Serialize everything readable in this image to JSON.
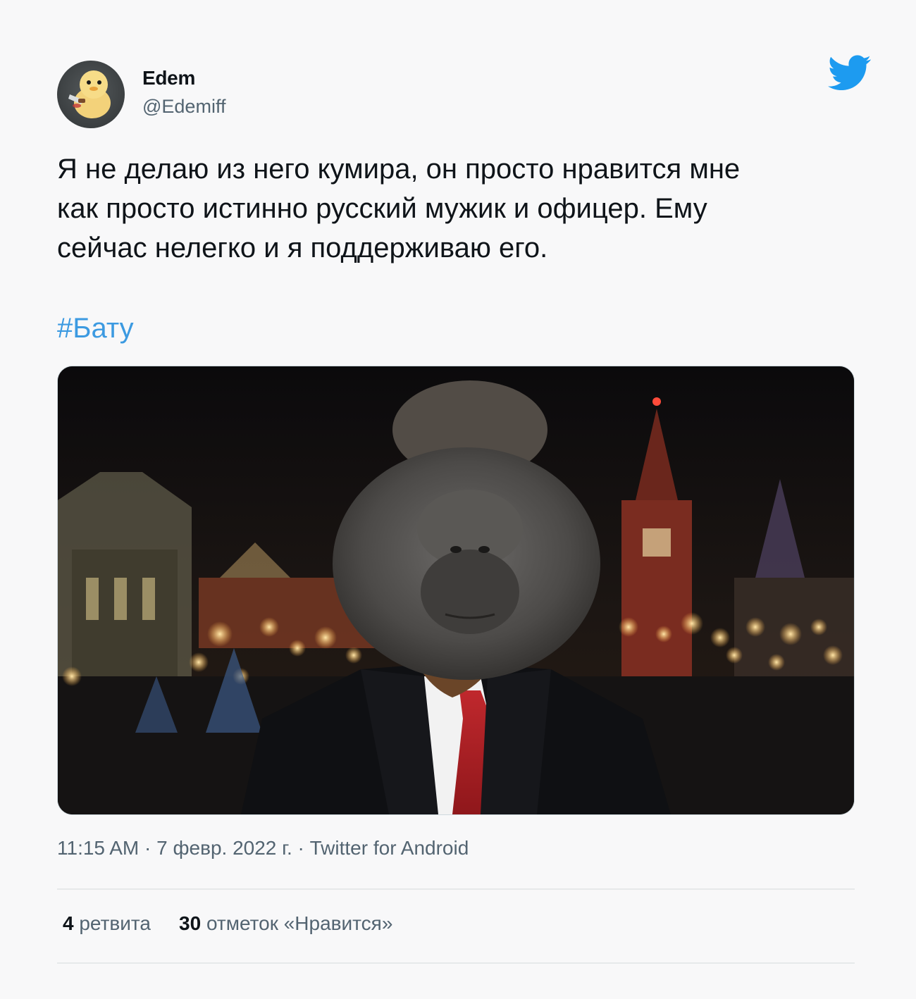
{
  "author": {
    "name": "Edem",
    "handle": "@Edemiff"
  },
  "tweet": {
    "text": "Я не делаю из него кумира, он просто нравится мне\nкак просто истинно русский мужик и офицер. Ему\nсейчас нелегко и я поддерживаю его.",
    "hashtag": "#Бату"
  },
  "meta": {
    "time": "11:15 AM",
    "separator1": "·",
    "date": "7 февр. 2022 г.",
    "separator2": "·",
    "source": "Twitter for Android"
  },
  "stats": {
    "retweets_count": "4",
    "retweets_label": "ретвита",
    "likes_count": "30",
    "likes_label": "отметок «Нравится»"
  },
  "colors": {
    "twitter_blue": "#1d9bf0",
    "hashtag": "#3c9ae1",
    "secondary_text": "#536471"
  },
  "icons": {
    "logo": "twitter-bird-icon"
  }
}
